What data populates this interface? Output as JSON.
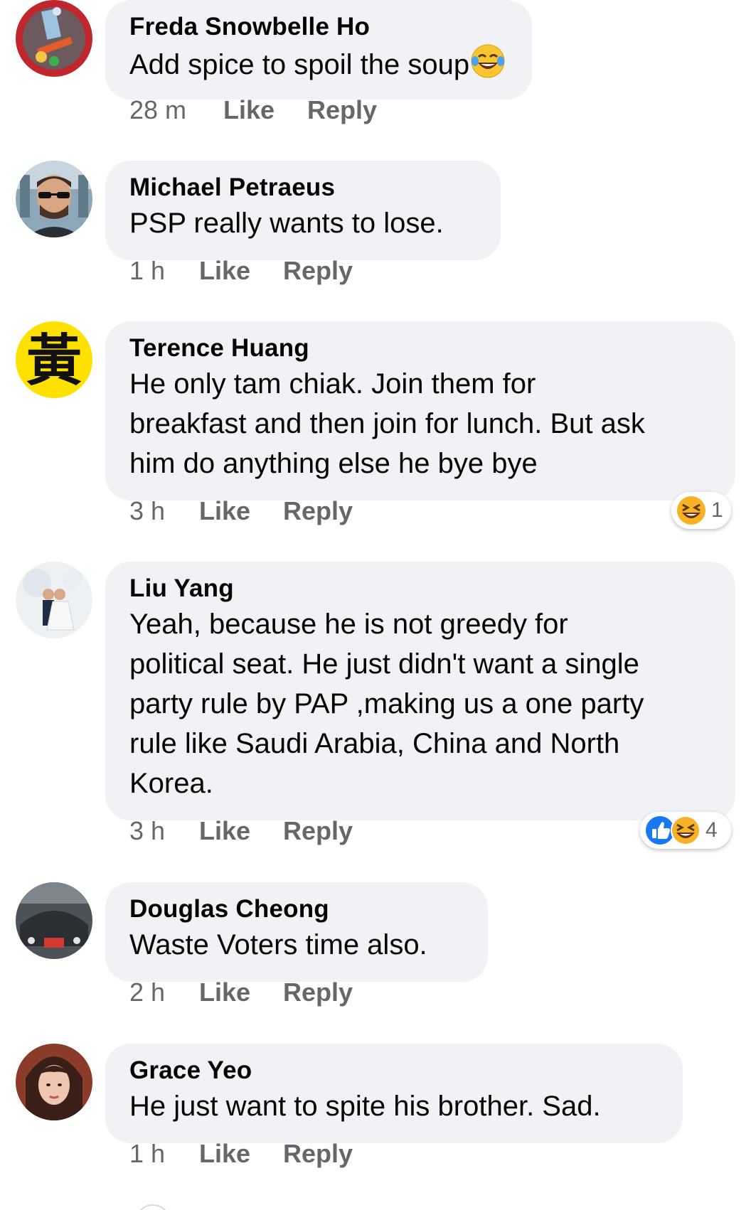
{
  "comments": [
    {
      "author": "Freda Snowbelle Ho",
      "text": "Add spice to spoil the soup",
      "inline_emoji": "laughing-tears-emoji",
      "time": "28 m",
      "like": "Like",
      "reply": "Reply"
    },
    {
      "author": "Michael Petraeus",
      "text": "PSP really wants to lose.",
      "time": "1 h",
      "like": "Like",
      "reply": "Reply"
    },
    {
      "author": "Terence Huang",
      "text": "He only tam chiak. Join them for\nbreakfast and then join for lunch. But ask\nhim do anything else he bye bye",
      "time": "3 h",
      "like": "Like",
      "reply": "Reply",
      "reactions": {
        "icons": [
          "haha-icon"
        ],
        "count": "1"
      }
    },
    {
      "author": "Liu Yang",
      "text": "Yeah, because he is not greedy for\npolitical seat. He just didn't want a single\nparty rule by PAP ,making us a one party\nrule like Saudi Arabia, China and North\nKorea.",
      "time": "3 h",
      "like": "Like",
      "reply": "Reply",
      "reactions": {
        "icons": [
          "like-icon",
          "haha-icon"
        ],
        "count": "4"
      }
    },
    {
      "author": "Douglas Cheong",
      "text": "Waste Voters time also.",
      "time": "2 h",
      "like": "Like",
      "reply": "Reply"
    },
    {
      "author": "Grace Yeo",
      "text": "He just want to spite his brother. Sad.",
      "time": "1 h",
      "like": "Like",
      "reply": "Reply"
    }
  ],
  "avatar_glyphs": {
    "terence": "黃"
  },
  "colors": {
    "bubble_bg": "#f0f2f5",
    "meta_text": "#65676b",
    "like_blue": "#1877f2",
    "haha_yellow": "#f7b125"
  }
}
